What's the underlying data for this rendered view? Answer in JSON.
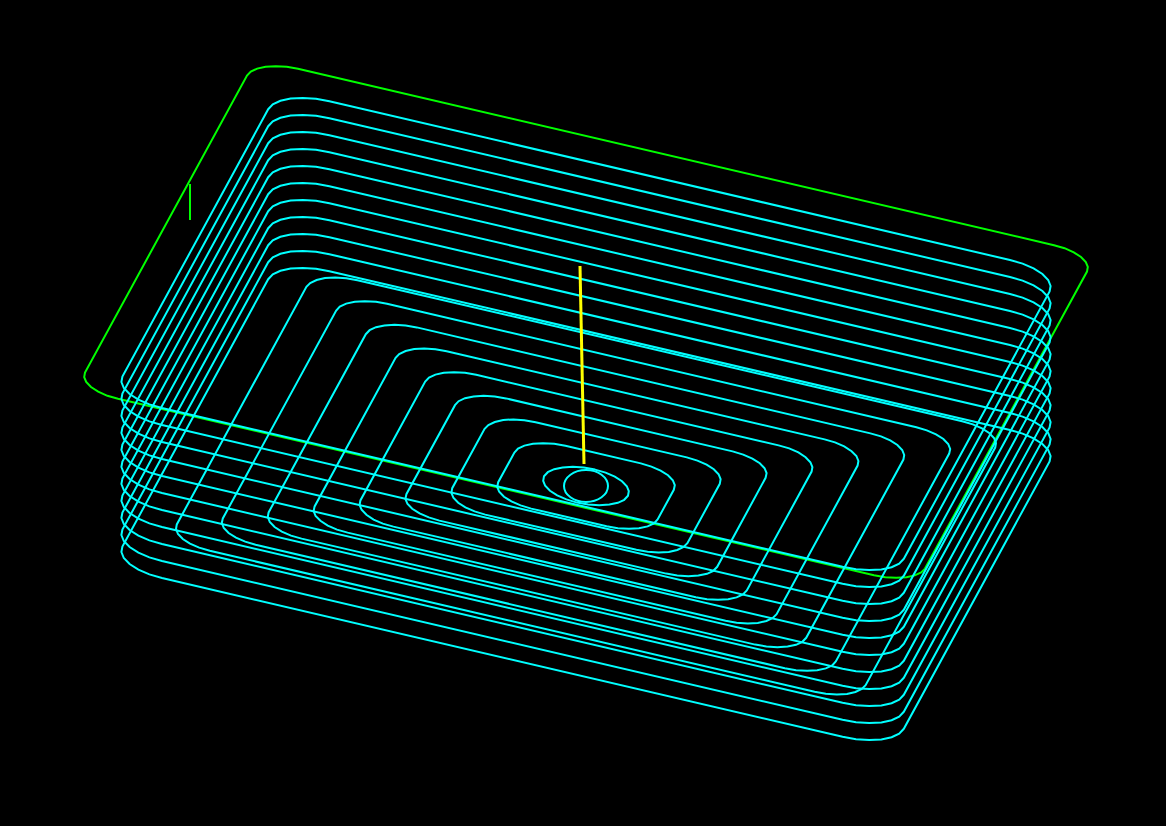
{
  "viewport": {
    "paths": [
      {
        "kind": "boundary",
        "color": "#00ff00"
      },
      {
        "kind": "toolpath",
        "color": "#00ffff"
      },
      {
        "kind": "plunge",
        "color": "#ffff00"
      }
    ]
  }
}
